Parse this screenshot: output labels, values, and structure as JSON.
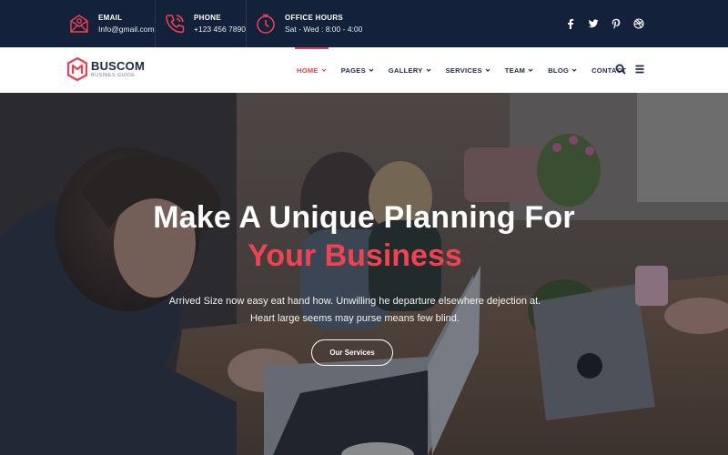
{
  "topbar": {
    "email": {
      "label": "EMAIL",
      "value": "Info@gmail.com",
      "icon": "mail-icon"
    },
    "phone": {
      "label": "PHONE",
      "value": "+123 456 7890",
      "icon": "phone-icon"
    },
    "hours": {
      "label": "OFFICE HOURS",
      "value": "Sat - Wed : 8:00 - 4:00",
      "icon": "clock-icon"
    },
    "social": [
      "facebook-icon",
      "twitter-icon",
      "pinterest-icon",
      "dribbble-icon"
    ]
  },
  "brand": {
    "name": "BUSCOM",
    "tagline": "BUSINES GUIDE",
    "color": "#e8404e"
  },
  "nav": {
    "items": [
      {
        "label": "HOME",
        "dropdown": true,
        "active": true
      },
      {
        "label": "PAGES",
        "dropdown": true
      },
      {
        "label": "GALLERY",
        "dropdown": true
      },
      {
        "label": "SERVICES",
        "dropdown": true
      },
      {
        "label": "TEAM",
        "dropdown": true
      },
      {
        "label": "BLOG",
        "dropdown": true
      },
      {
        "label": "CONTACT",
        "dropdown": false
      }
    ],
    "tools": [
      "search-icon",
      "menu-icon"
    ]
  },
  "hero": {
    "title": "Make A Unique Planning For",
    "accent": "Your Business",
    "description": "Arrived Size now easy eat hand how. Unwilling he departure elsewhere dejection at. Heart large seems may purse means few blind.",
    "button_label": "Our Services",
    "accent_color": "#f04352"
  },
  "colors": {
    "topbar_bg": "#14213a",
    "accent": "#e8404e",
    "nav_text": "#1b2a44"
  }
}
